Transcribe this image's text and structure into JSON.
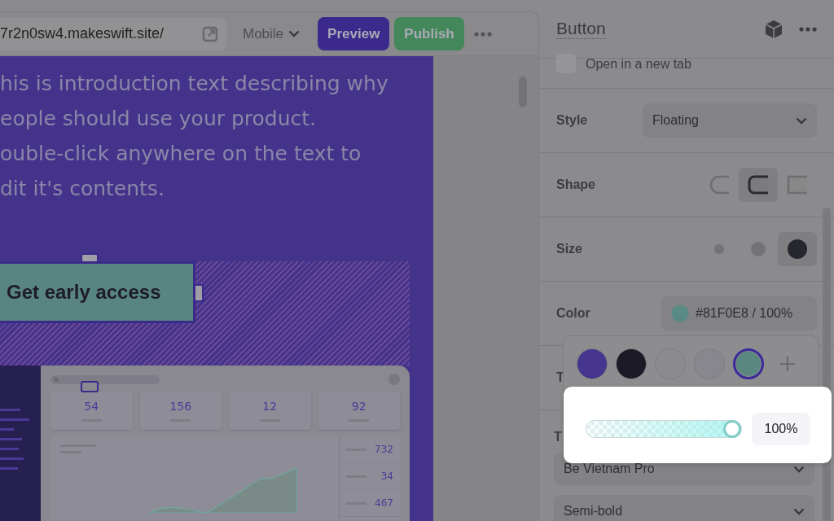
{
  "toolbar": {
    "url": "7r2n0sw4.makeswift.site/",
    "device": "Mobile",
    "buttons": [
      {
        "label": "Preview",
        "kind": "preview"
      },
      {
        "label": "Publish",
        "kind": "publish"
      }
    ]
  },
  "canvas": {
    "intro_lines": [
      "his is introduction text describing why",
      "eople should use your product.",
      "ouble-click anywhere on the text to",
      "dit it's contents."
    ],
    "cta": "Get early access",
    "dashboard": {
      "stats": [
        "54",
        "156",
        "12",
        "92"
      ],
      "list_values": [
        "732",
        "34",
        "467"
      ]
    }
  },
  "inspector": {
    "title": "Button",
    "open_new_tab": {
      "label": "Open in a new tab",
      "checked": false
    },
    "style": {
      "label": "Style",
      "value": "Floating"
    },
    "shape": {
      "label": "Shape",
      "options": [
        {
          "kind": "pill",
          "selected": false
        },
        {
          "kind": "rounded",
          "selected": true
        },
        {
          "kind": "square",
          "selected": false
        }
      ]
    },
    "size": {
      "label": "Size",
      "options": [
        {
          "kind": "small",
          "selected": false
        },
        {
          "kind": "medium",
          "selected": false
        },
        {
          "kind": "large",
          "selected": true
        }
      ]
    },
    "color": {
      "label": "Color",
      "value": "#81F0E8 / 100%",
      "color": "#5a8a84"
    },
    "hidden_rows": [
      {
        "label": "T"
      },
      {
        "label": "T"
      }
    ],
    "font": {
      "family": "Be Vietnam Pro",
      "weight": "Semi-bold"
    }
  },
  "color_popover": {
    "swatches": [
      {
        "color": "#45358f",
        "selected": false
      },
      {
        "color": "#1c1a26",
        "selected": false
      },
      {
        "color": "#8b8b8d",
        "selected": false
      },
      {
        "color": "#88878d",
        "selected": false
      },
      {
        "color": "#5a8780",
        "selected": true
      }
    ],
    "opacity": {
      "level": 1,
      "reading": "100%"
    }
  }
}
